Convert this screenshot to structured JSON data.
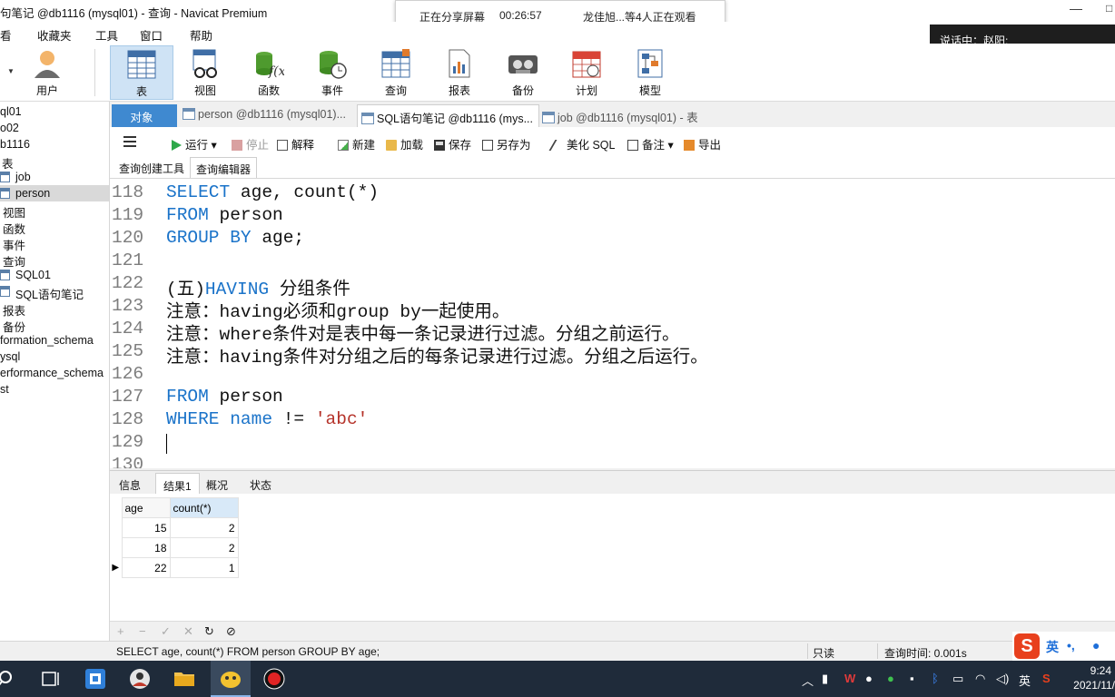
{
  "window": {
    "title": "句笔记 @db1116 (mysql01) - 查询 - Navicat Premium",
    "minimize": "—",
    "maximize": "□"
  },
  "share_banner": {
    "status": "正在分享屏幕",
    "timer": "00:26:57",
    "viewers": "龙佳旭...等4人正在观看"
  },
  "speaking": "说话中：赵阳;",
  "menu": [
    "看",
    "收藏夹",
    "工具",
    "窗口",
    "帮助"
  ],
  "toolbar": {
    "items": [
      {
        "label": "用户",
        "icon": "user-icon"
      },
      {
        "label": "表",
        "icon": "table-icon"
      },
      {
        "label": "视图",
        "icon": "view-icon"
      },
      {
        "label": "函数",
        "icon": "function-icon"
      },
      {
        "label": "事件",
        "icon": "event-icon"
      },
      {
        "label": "查询",
        "icon": "query-icon"
      },
      {
        "label": "报表",
        "icon": "report-icon"
      },
      {
        "label": "备份",
        "icon": "backup-icon"
      },
      {
        "label": "计划",
        "icon": "schedule-icon"
      },
      {
        "label": "模型",
        "icon": "model-icon"
      }
    ],
    "active": "表"
  },
  "nav": {
    "items": [
      "ql01",
      "o02",
      "b1116",
      "表",
      "job",
      "person",
      "视图",
      "函数",
      "事件",
      "查询",
      "SQL01",
      "SQL语句笔记",
      "报表",
      "备份",
      "formation_schema",
      "ysql",
      "erformance_schema",
      "st"
    ],
    "selected": "person"
  },
  "tabs": {
    "objects": "对象",
    "open": [
      "person @db1116 (mysql01)...",
      "SQL语句笔记 @db1116 (mys...",
      "job @db1116 (mysql01) - 表"
    ]
  },
  "query_toolbar": {
    "run": "运行",
    "stop": "停止",
    "explain": "解释",
    "new": "新建",
    "load": "加载",
    "save": "保存",
    "save_as": "另存为",
    "beautify": "美化 SQL",
    "comment": "备注",
    "export": "导出"
  },
  "subtabs": [
    "查询创建工具",
    "查询编辑器"
  ],
  "editor": {
    "lines": [
      {
        "n": "118",
        "parts": [
          [
            "kw",
            "SELECT"
          ],
          [
            "",
            " age, count(*)"
          ]
        ]
      },
      {
        "n": "119",
        "parts": [
          [
            "kw",
            "FROM"
          ],
          [
            "",
            " person"
          ]
        ]
      },
      {
        "n": "120",
        "parts": [
          [
            "kw",
            "GROUP BY"
          ],
          [
            "",
            " age;"
          ]
        ]
      },
      {
        "n": "121",
        "parts": []
      },
      {
        "n": "122",
        "parts": [
          [
            "",
            "(五)"
          ],
          [
            "kw",
            "HAVING"
          ],
          [
            "",
            " 分组条件"
          ]
        ]
      },
      {
        "n": "123",
        "parts": [
          [
            "",
            "注意：having必须和group by一起使用。"
          ]
        ]
      },
      {
        "n": "124",
        "parts": [
          [
            "",
            "注意：where条件对是表中每一条记录进行过滤。分组之前运行。"
          ]
        ]
      },
      {
        "n": "125",
        "parts": [
          [
            "",
            "注意：having条件对分组之后的每条记录进行过滤。分组之后运行。"
          ]
        ]
      },
      {
        "n": "126",
        "parts": []
      },
      {
        "n": "127",
        "parts": [
          [
            "kw",
            "FROM"
          ],
          [
            "",
            " person"
          ]
        ]
      },
      {
        "n": "128",
        "parts": [
          [
            "kw",
            "WHERE"
          ],
          [
            "",
            " "
          ],
          [
            "kw",
            "name"
          ],
          [
            "",
            " != "
          ],
          [
            "str",
            "'abc'"
          ]
        ]
      },
      {
        "n": "129",
        "parts": []
      },
      {
        "n": "130",
        "parts": []
      }
    ],
    "colors": {
      "keyword": "#1a73c9",
      "string": "#b5332a",
      "line_number": "#7d7d7d"
    }
  },
  "result_tabs": [
    "信息",
    "结果1",
    "概况",
    "状态"
  ],
  "result": {
    "columns": [
      "age",
      "count(*)"
    ],
    "rows": [
      [
        "15",
        "2"
      ],
      [
        "18",
        "2"
      ],
      [
        "22",
        "1"
      ]
    ],
    "current_row": 2
  },
  "grid_controls": [
    "+",
    "−",
    "✓",
    "✕",
    "↻",
    "⊘"
  ],
  "status": {
    "sql": "SELECT age, count(*) FROM person GROUP BY age;",
    "readonly": "只读",
    "query_time": "查询时间: 0.001s"
  },
  "ime": {
    "logo": "S",
    "lang": "英",
    "punct": "•,"
  },
  "taskbar": {
    "tray_lang": "英",
    "time": "9:24",
    "date": "2021/11/"
  }
}
